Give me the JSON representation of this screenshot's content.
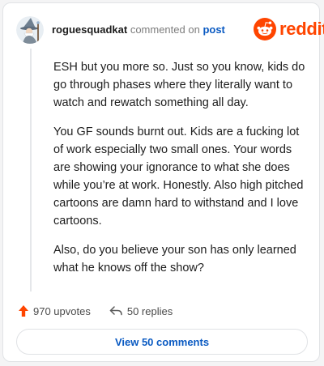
{
  "comment": {
    "username": "roguesquadkat",
    "action_text": "commented on",
    "post_link_label": "post",
    "avatar_icon": "wizard-avatar-icon",
    "paragraphs": [
      "ESH but you more so. Just so you know, kids do go through phases where they literally want to watch and rewatch something all day.",
      "You GF sounds burnt out. Kids are a fucking lot of work especially two small ones. Your words are showing your ignorance to what she does while you’re at work. Honestly. Also high pitched cartoons are damn hard to withstand and I love cartoons.",
      "Also, do you believe your son has only learned what he knows off the show?"
    ]
  },
  "brand": {
    "wordmark": "reddit",
    "icon": "reddit-snoo-icon",
    "color": "#ff4500"
  },
  "footer": {
    "upvotes_label": "970 upvotes",
    "upvote_icon": "upvote-arrow-icon",
    "upvote_color": "#ff4500",
    "replies_label": "50 replies",
    "reply_icon": "reply-arrow-icon"
  },
  "view_comments_label": "View 50 comments",
  "colors": {
    "link": "#0a5ac2",
    "text": "#1c1c1c",
    "muted": "#7c7c7c"
  }
}
